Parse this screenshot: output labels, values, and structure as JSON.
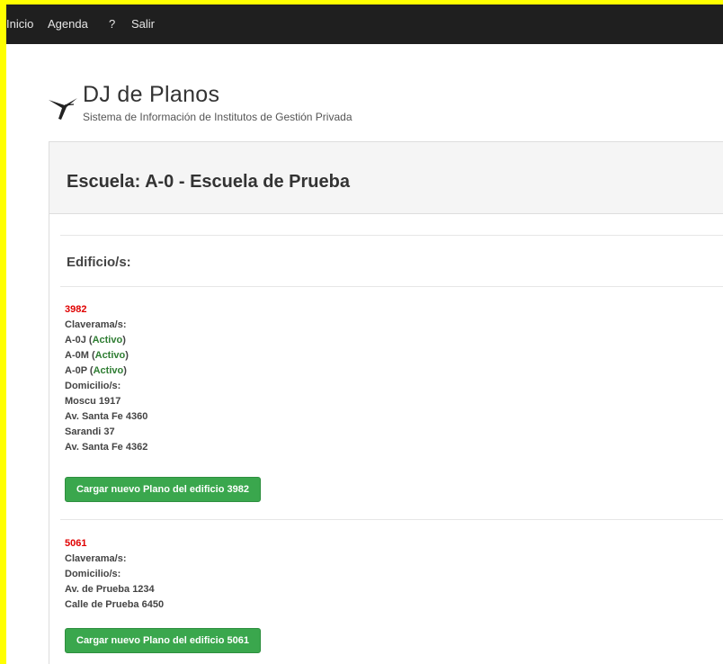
{
  "nav": {
    "items": [
      "Inicio",
      "Agenda",
      "?",
      "Salir"
    ]
  },
  "brand": {
    "title": "DJ de Planos",
    "subtitle": "Sistema de Información de Institutos de Gestión Privada"
  },
  "panel": {
    "title": "Escuela: A-0 - Escuela de Prueba",
    "section_title": "Edificio/s:"
  },
  "buildings": [
    {
      "code": "3982",
      "claverama_label": "Claverama/s:",
      "claveramas": [
        {
          "code": "A-0J",
          "status": "Activo"
        },
        {
          "code": "A-0M",
          "status": "Activo"
        },
        {
          "code": "A-0P",
          "status": "Activo"
        }
      ],
      "domicilio_label": "Domicilio/s:",
      "domicilios": [
        "Moscu 1917",
        "Av. Santa Fe 4360",
        "Sarandi 37",
        "Av. Santa Fe 4362"
      ],
      "button_label": "Cargar nuevo Plano del edificio 3982"
    },
    {
      "code": "5061",
      "claverama_label": "Claverama/s:",
      "claveramas": [],
      "domicilio_label": "Domicilio/s:",
      "domicilios": [
        "Av. de Prueba 1234",
        "Calle de Prueba 6450"
      ],
      "button_label": "Cargar nuevo Plano del edificio 5061"
    }
  ],
  "colors": {
    "highlight_border": "#ffff00",
    "navbar_bg": "#1f1f1f",
    "code_red": "#e00000",
    "active_green": "#2e7d32",
    "button_green": "#3aa74d"
  }
}
